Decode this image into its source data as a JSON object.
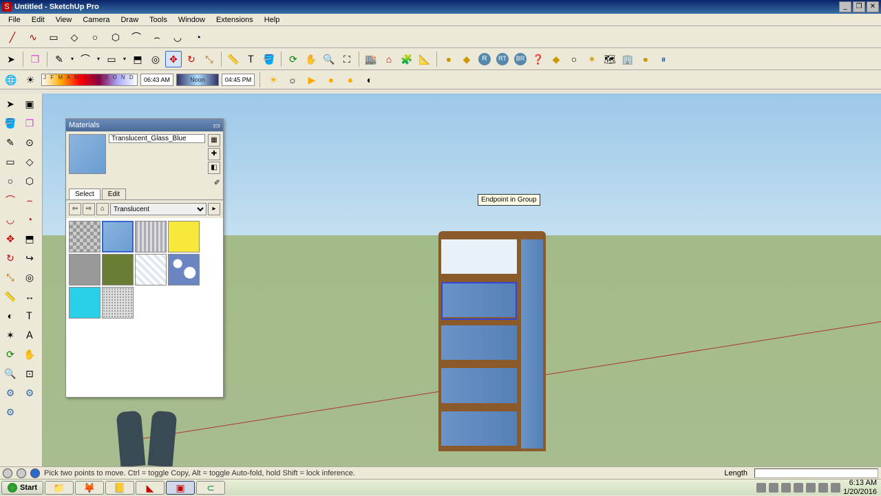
{
  "window": {
    "title": "Untitled - SketchUp Pro",
    "app_icon_glyph": "S"
  },
  "menubar": [
    "File",
    "Edit",
    "View",
    "Camera",
    "Draw",
    "Tools",
    "Window",
    "Extensions",
    "Help"
  ],
  "shadow_toolbar": {
    "months": "J F M A M J J A S O N D",
    "time_start": "06:43 AM",
    "noon_label": "Noon",
    "time_end": "04:45 PM"
  },
  "materials": {
    "panel_title": "Materials",
    "current_name": "Translucent_Glass_Blue",
    "tabs": {
      "select": "Select",
      "edit": "Edit"
    },
    "library_dropdown": "Translucent",
    "swatches_alt": [
      "checker",
      "blue",
      "stripe",
      "yellow",
      "gray",
      "olive",
      "lightgrid",
      "clouds",
      "cyan",
      "noise"
    ]
  },
  "inference_tooltip": "Endpoint in Group",
  "statusbar": {
    "hint": "Pick two points to move.  Ctrl = toggle Copy, Alt = toggle Auto-fold, hold Shift = lock inference.",
    "length_label": "Length"
  },
  "taskbar": {
    "start_label": "Start",
    "clock_time": "6:13 AM",
    "clock_date": "1/20/2016"
  }
}
